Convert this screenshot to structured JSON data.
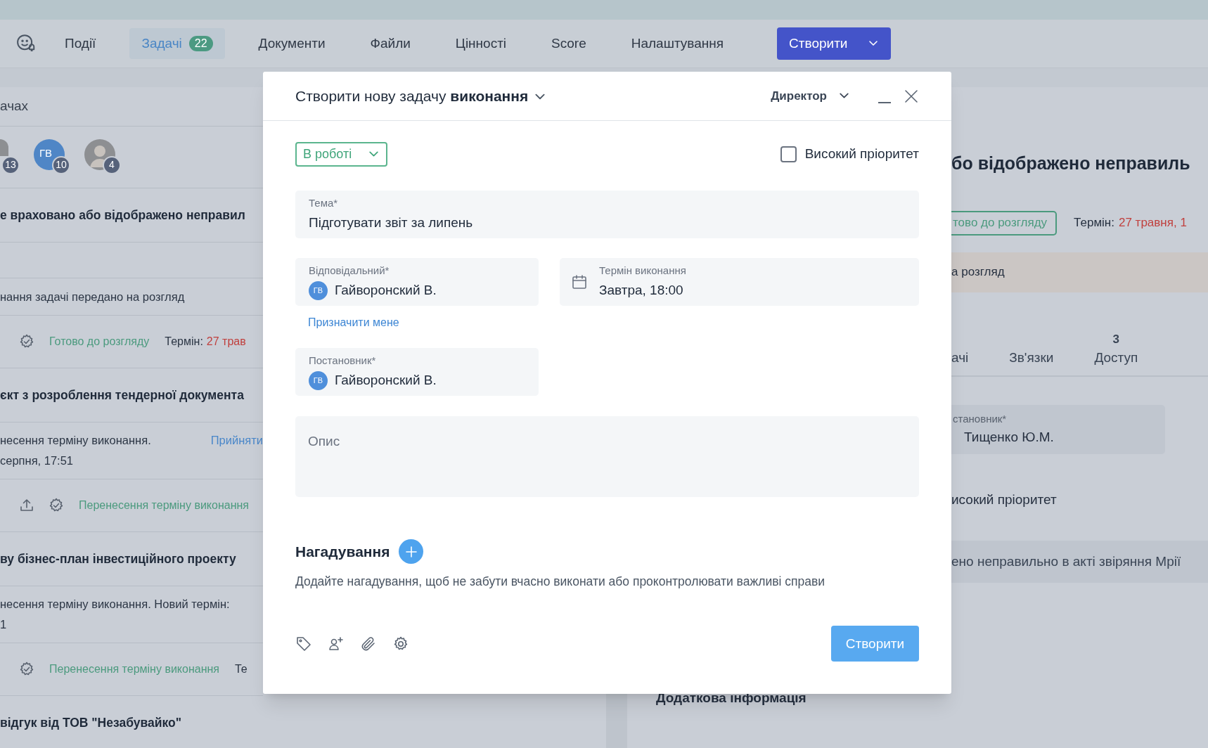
{
  "nav": {
    "items": [
      {
        "label": "Події",
        "selected": false
      },
      {
        "label": "Задачі",
        "badge": "22",
        "selected": true
      },
      {
        "label": "Документи",
        "selected": false
      },
      {
        "label": "Файли",
        "selected": false
      },
      {
        "label": "Цінності",
        "selected": false
      },
      {
        "label": "Score",
        "selected": false
      },
      {
        "label": "Налаштування",
        "selected": false
      }
    ],
    "create_button": "Створити"
  },
  "left_list": [
    {
      "kind": "header",
      "text": "ачах"
    },
    {
      "kind": "avatars",
      "avatars": [
        {
          "kind": "photo_cut",
          "count": "13"
        },
        {
          "kind": "initials",
          "initials": "ГВ",
          "count": "10"
        },
        {
          "kind": "photo",
          "count": "4"
        }
      ]
    },
    {
      "kind": "title",
      "text": "е враховано або відображено неправил"
    },
    {
      "kind": "blank"
    },
    {
      "kind": "text",
      "lines": [
        "нання задачі передано на розгляд"
      ]
    },
    {
      "kind": "meta",
      "upload": false,
      "status": "Готово до розгляду",
      "due_label": "Термін:",
      "due_value": "27 трав"
    },
    {
      "kind": "title",
      "text": "єкт з розроблення тендерної документа"
    },
    {
      "kind": "text",
      "lines": [
        "несення терміну виконання.",
        "серпня, 17:51"
      ],
      "link": "Прийняти"
    },
    {
      "kind": "meta",
      "upload": true,
      "status": "Перенесення терміну виконання"
    },
    {
      "kind": "title",
      "text": "ву бізнес-план інвестиційного проекту"
    },
    {
      "kind": "text",
      "lines": [
        "несення терміну виконання. Новий термін:",
        "1"
      ]
    },
    {
      "kind": "meta",
      "upload": false,
      "status": "Перенесення терміну виконання",
      "due_label": "Те"
    },
    {
      "kind": "title",
      "text": "відгук від ТОВ \"Незабувайко\""
    }
  ],
  "right_panel": {
    "title": "бо відображено неправиль",
    "status": "тово до розгляду",
    "due_label": "Термін:",
    "due_value": "27 травня, 1",
    "banner": "а розгляд",
    "tabs": [
      {
        "label": "ачі"
      },
      {
        "label": "Зв'язки"
      },
      {
        "label": "Доступ",
        "count": "3"
      }
    ],
    "author": {
      "label": "становник*",
      "value": "Тищенко Ю.М."
    },
    "priority_label": "исокий пріоритет",
    "note": "ено неправильно в акті звіряння Мрії",
    "extra": "Додаткова інформація"
  },
  "modal": {
    "title": "Створити нову задачу **виконання**",
    "role": "Директор",
    "status": "В роботі",
    "high_priority": {
      "label": "Високий пріоритет",
      "checked": false
    },
    "subject": {
      "label": "Тема*",
      "value": "Підготувати звіт за липень"
    },
    "assignee": {
      "label": "Відповідальний*",
      "initials": "ГВ",
      "name": "Гайворонский В."
    },
    "due": {
      "label": "Термін виконання",
      "value": "Завтра, 18:00"
    },
    "assign_me": "Призначити мене",
    "author": {
      "label": "Постановник*",
      "initials": "ГВ",
      "name": "Гайворонский В."
    },
    "description": {
      "placeholder": "Опис"
    },
    "reminders": {
      "title": "Нагадування",
      "hint": "Додайте нагадування, щоб не забути вчасно виконати або проконтролювати важливі справи"
    },
    "submit": "Створити"
  }
}
